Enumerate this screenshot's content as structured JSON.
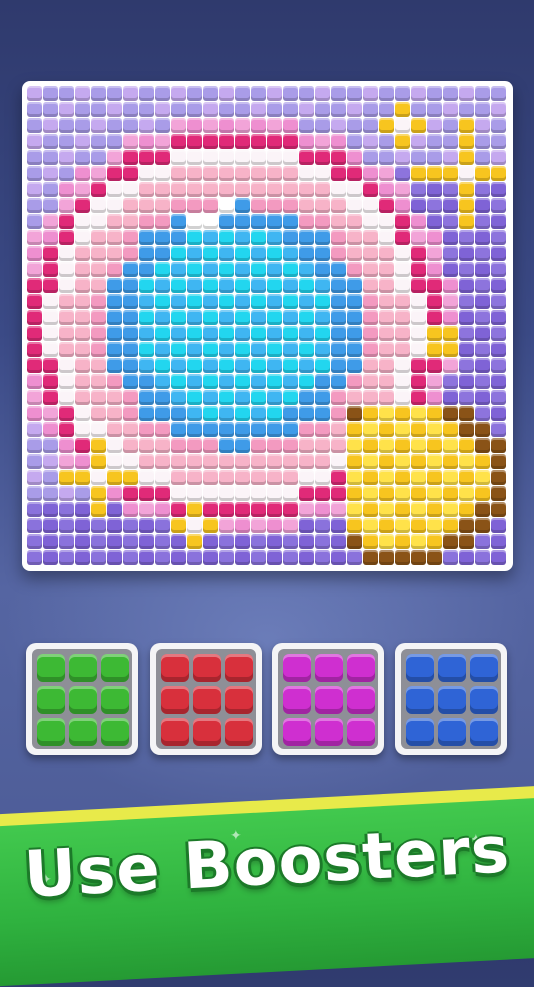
{
  "banner": {
    "title": "Use Boosters"
  },
  "colors": {
    "background": "#3b4a86",
    "board_frame": "#ffffff",
    "banner_green": "#2fb23f",
    "banner_yellow": "#e8ea4a"
  },
  "puzzle": {
    "subject": "magic mirror",
    "palette": [
      "lavender",
      "pink",
      "magenta",
      "white",
      "light-pink",
      "cyan",
      "blue",
      "yellow",
      "brown",
      "purple"
    ]
  },
  "boosters": [
    {
      "name": "green-block-booster",
      "color": "#3db934"
    },
    {
      "name": "red-block-booster",
      "color": "#d8303c"
    },
    {
      "name": "magenta-block-booster",
      "color": "#cf2fd0"
    },
    {
      "name": "blue-block-booster",
      "color": "#2f64d6"
    }
  ]
}
